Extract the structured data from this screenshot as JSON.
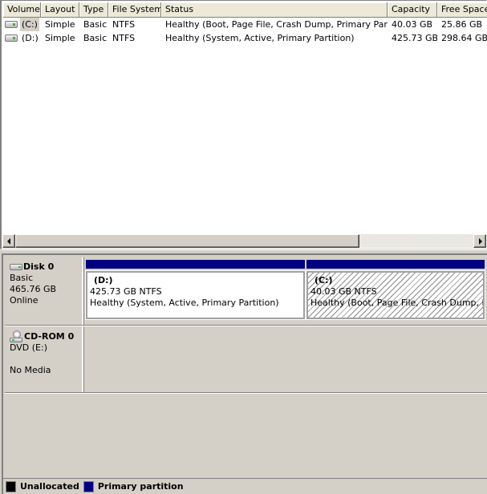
{
  "volume_list": {
    "columns": [
      "Volume",
      "Layout",
      "Type",
      "File System",
      "Status",
      "Capacity",
      "Free Space"
    ],
    "rows": [
      {
        "icon": "hard-drive-icon",
        "volume": "(C:)",
        "layout": "Simple",
        "type": "Basic",
        "file_system": "NTFS",
        "status": "Healthy (Boot, Page File, Crash Dump, Primary Partition)",
        "capacity": "40.03 GB",
        "free_space": "25.86 GB",
        "selected": true
      },
      {
        "icon": "hard-drive-icon",
        "volume": "(D:)",
        "layout": "Simple",
        "type": "Basic",
        "file_system": "NTFS",
        "status": "Healthy (System, Active, Primary Partition)",
        "capacity": "425.73 GB",
        "free_space": "298.64 GB",
        "selected": false
      }
    ]
  },
  "disks": [
    {
      "icon": "hard-drive-icon",
      "name": "Disk 0",
      "type": "Basic",
      "size": "465.76 GB",
      "status": "Online",
      "partitions": [
        {
          "title": "(D:)",
          "size_fs": "425.73 GB NTFS",
          "status": "Healthy (System, Active, Primary Partition)",
          "style": "white"
        },
        {
          "title": "(C:)",
          "size_fs": "40.03 GB NTFS",
          "status": "Healthy (Boot, Page File, Crash Dump, Primary Partition)",
          "style": "hatched"
        }
      ]
    },
    {
      "icon": "cd-rom-icon",
      "name": "CD-ROM 0",
      "type": "DVD (E:)",
      "size": "",
      "status": "No Media",
      "partitions": []
    }
  ],
  "legend": [
    {
      "label": "Unallocated",
      "color": "#000000"
    },
    {
      "label": "Primary partition",
      "color": "#000080"
    }
  ]
}
